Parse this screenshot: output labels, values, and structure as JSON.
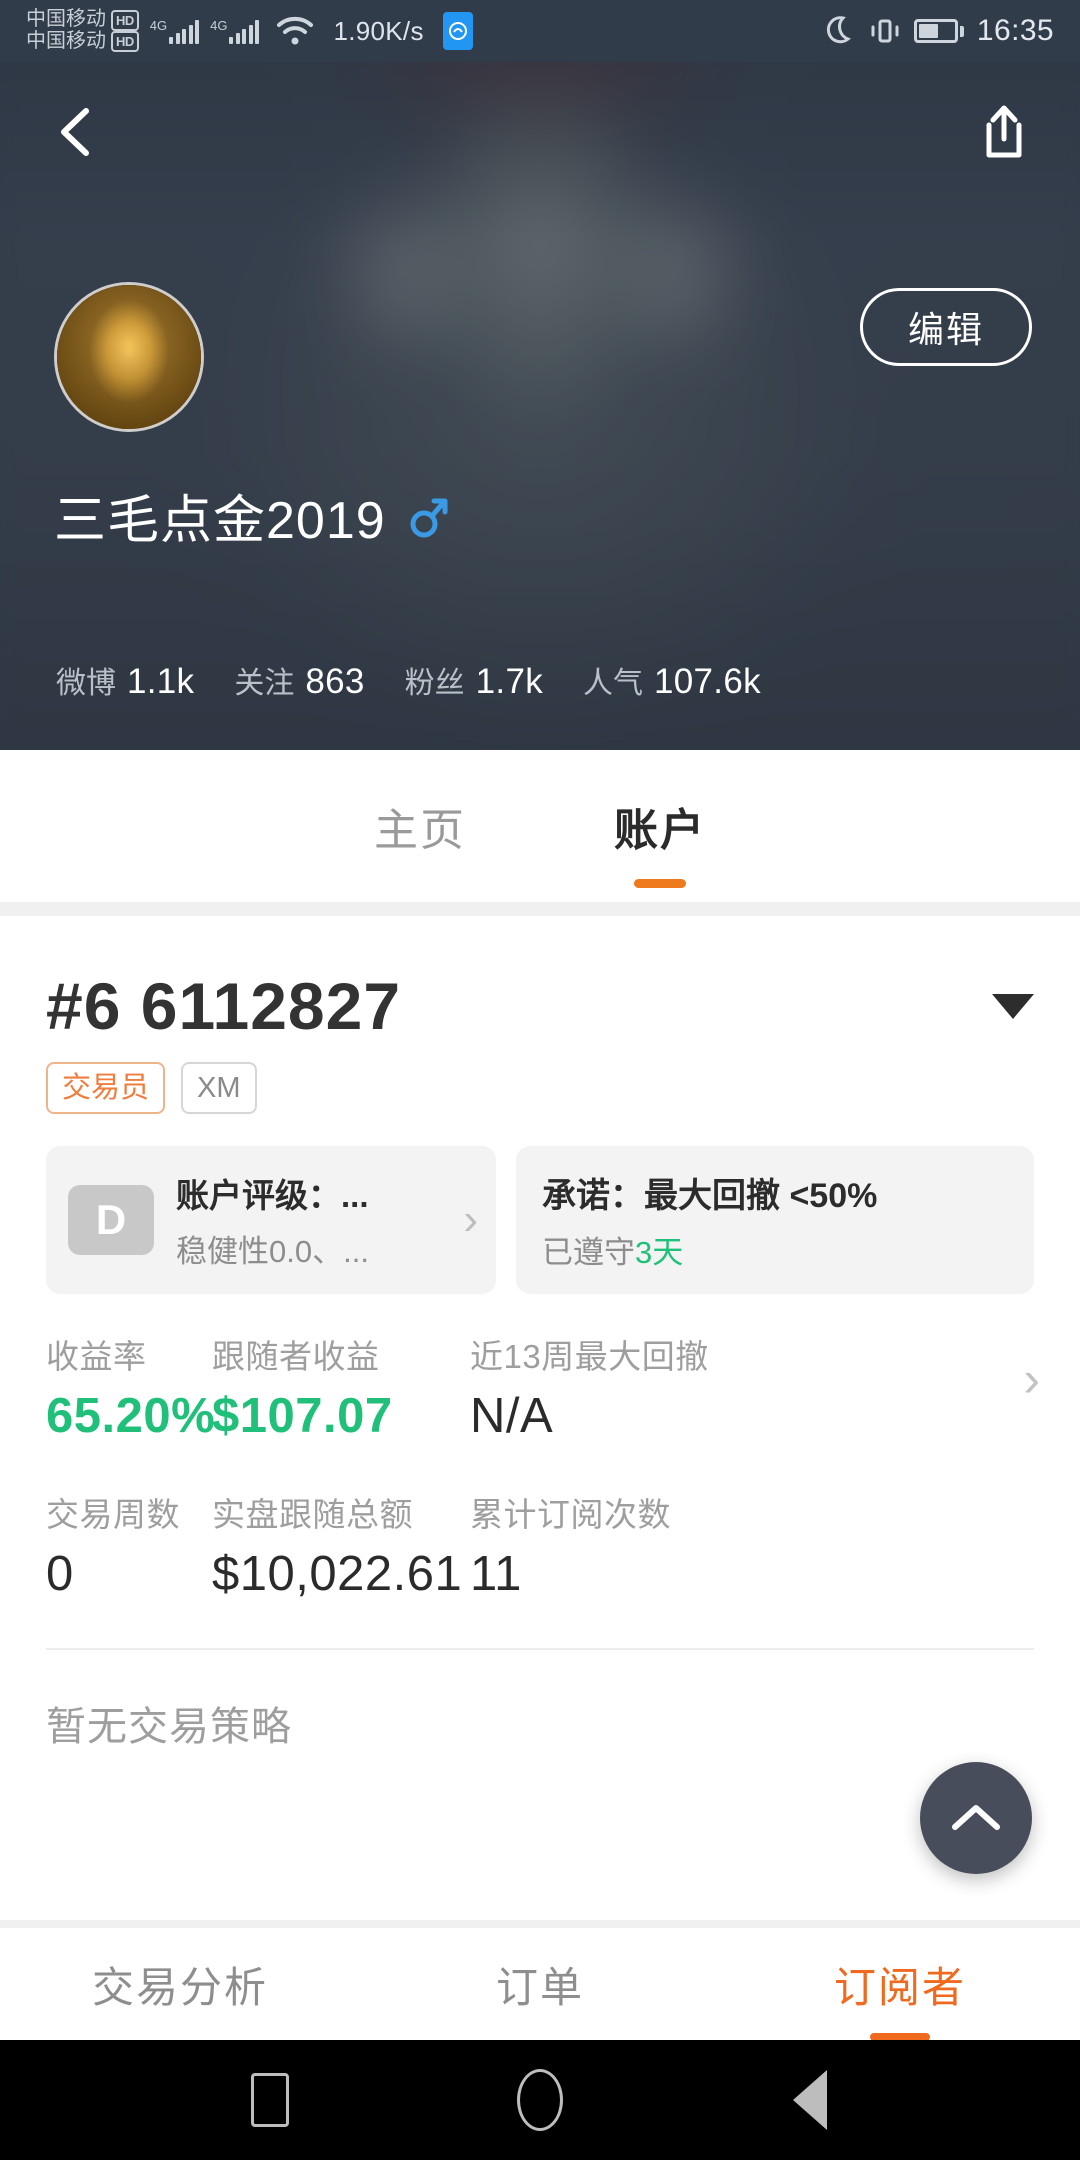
{
  "status_bar": {
    "carrier_line_1": "中国移动",
    "carrier_line_2": "中国移动",
    "hd_badge": "HD",
    "network_1": "4G",
    "network_2": "4G",
    "speed": "1.90K/s",
    "time": "16:35"
  },
  "hero": {
    "back_icon": "back-chevron-icon",
    "share_icon": "share-icon",
    "edit_label": "编辑",
    "username": "三毛点金2019",
    "gender": "male",
    "stats": [
      {
        "label": "微博",
        "value": "1.1k"
      },
      {
        "label": "关注",
        "value": "863"
      },
      {
        "label": "粉丝",
        "value": "1.7k"
      },
      {
        "label": "人气",
        "value": "107.6k"
      }
    ]
  },
  "top_tabs": [
    {
      "label": "主页",
      "active": false
    },
    {
      "label": "账户",
      "active": true
    }
  ],
  "account": {
    "title": "#6 6112827",
    "badges": [
      {
        "text": "交易员",
        "type": "trader"
      },
      {
        "text": "XM",
        "type": "broker"
      }
    ],
    "rating_card": {
      "grade": "D",
      "title": "账户评级：...",
      "subtitle": "稳健性0.0、...",
      "chevron": "chevron-right-icon"
    },
    "promise_card": {
      "title": "承诺：最大回撤 <50%",
      "status_prefix": "已遵守",
      "status_highlight": "3天"
    },
    "metrics_row_1": [
      {
        "label": "收益率",
        "value": "65.20%",
        "color": "green"
      },
      {
        "label": "跟随者收益",
        "value": "$107.07",
        "color": "green"
      },
      {
        "label": "近13周最大回撤",
        "value": "N/A",
        "color": "dark"
      }
    ],
    "metrics_row_2": [
      {
        "label": "交易周数",
        "value": "0",
        "color": "dark"
      },
      {
        "label": "实盘跟随总额",
        "value": "$10,022.61",
        "color": "dark"
      },
      {
        "label": "累计订阅次数",
        "value": "11",
        "color": "dark"
      }
    ],
    "empty_strategy": "暂无交易策略"
  },
  "fab": {
    "icon": "chevron-up-icon"
  },
  "bottom_tabs": [
    {
      "label": "交易分析",
      "active": false
    },
    {
      "label": "订单",
      "active": false
    },
    {
      "label": "订阅者",
      "active": true
    }
  ],
  "nav_bar": [
    {
      "icon": "recents-square-icon"
    },
    {
      "icon": "home-circle-icon"
    },
    {
      "icon": "back-triangle-icon"
    }
  ],
  "colors": {
    "accent_orange": "#ef6a1e",
    "green": "#20c07a",
    "hero_bg": "#333d4c"
  }
}
